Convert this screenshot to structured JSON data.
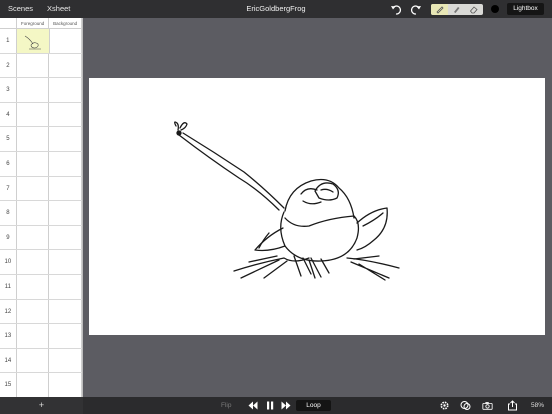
{
  "topbar": {
    "nav": [
      "Scenes",
      "Xsheet"
    ],
    "title": "EricGoldbergFrog",
    "lightbox_label": "Lightbox",
    "current_color": "#000000"
  },
  "xsheet": {
    "columns": [
      "Foreground",
      "Background"
    ],
    "rows": [
      "1",
      "2",
      "3",
      "4",
      "5",
      "6",
      "7",
      "8",
      "9",
      "10",
      "11",
      "12",
      "13",
      "14",
      "15"
    ],
    "active_cell": "Foreground frame 1"
  },
  "bottombar": {
    "add_label": "+",
    "flip_label": "Flip",
    "loop_label": "Loop",
    "zoom": "58%"
  },
  "colors": {
    "toolbar_bg": "#2f2f31",
    "workspace_bg": "#5c5c62",
    "active_cell_bg": "#f4f7c5",
    "selected_tool_bg": "#e8e7b6"
  }
}
